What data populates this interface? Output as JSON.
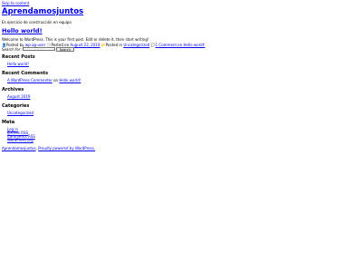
{
  "skip_link": "Skip to content",
  "site": {
    "title": "Aprendamosjuntos",
    "description": "Es ejercicio de construcción en equipo"
  },
  "post": {
    "title": "Hello world!",
    "content": "Welcome to WordPress. This is your first post. Edit or delete it, then start writing!",
    "meta": {
      "posted_by_prefix": "Posted by",
      "author": "wp-ag-user",
      "posted_on_prefix": "Posted on",
      "date": "August 22, 2019",
      "posted_in_prefix": "Posted in",
      "category": "Uncategorized",
      "comment_prefix": "1",
      "comment_link": "Comment on Hello world!"
    }
  },
  "search": {
    "label": "Search for:",
    "placeholder": "",
    "button": "Search"
  },
  "widgets": {
    "recent_posts": {
      "title": "Recent Posts",
      "items": [
        "Hello world!"
      ]
    },
    "recent_comments": {
      "title": "Recent Comments",
      "author": "A WordPress Commenter",
      "on": "on",
      "post": "Hello world!"
    },
    "archives": {
      "title": "Archives",
      "items": [
        "August 2019"
      ]
    },
    "categories": {
      "title": "Categories",
      "items": [
        "Uncategorized"
      ]
    },
    "meta": {
      "title": "Meta",
      "items": [
        "Log in",
        "Entries RSS",
        "Comments RSS",
        "WordPress.org"
      ]
    }
  },
  "footer": {
    "site_link": "Aprendamosjuntos",
    "separator": ",",
    "proudly": "Proudly powered by WordPress."
  }
}
